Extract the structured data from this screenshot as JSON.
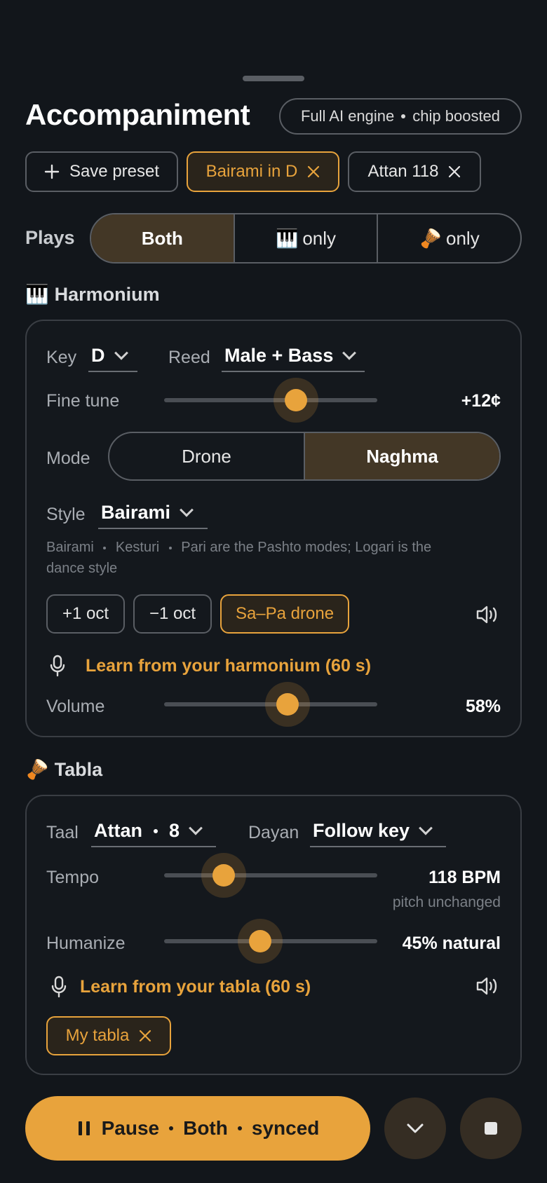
{
  "header": {
    "title": "Accompaniment",
    "engine_left": "Full AI engine",
    "engine_right": "chip boosted"
  },
  "chips": [
    {
      "label": "Save preset",
      "icon": "plus-icon"
    },
    {
      "label": "Bairami in D",
      "active": true
    },
    {
      "label": "Attan 118"
    }
  ],
  "plays": {
    "label": "Plays",
    "options": [
      "Both",
      "only",
      "only"
    ],
    "selected": "Both"
  },
  "harmonium": {
    "heading": "Harmonium",
    "key_label": "Key",
    "key_value": "D",
    "reed_label": "Reed",
    "reed_value": "Male + Bass",
    "fine_tune_label": "Fine tune",
    "fine_tune_value": "+12¢",
    "fine_tune_level": 0.62,
    "mode_label": "Mode",
    "modes": [
      "Drone",
      "Naghma"
    ],
    "mode_selected": "Naghma",
    "style_label": "Style",
    "style_value": "Bairami",
    "hint_a": "Bairami",
    "hint_b": "Kesturi",
    "hint_c": "Pari are the Pashto modes; Logari is the",
    "hint_d": "dance style",
    "buttons": [
      "+1 oct",
      "−1 oct",
      "Sa–Pa drone"
    ],
    "learn": "Learn from your harmonium (60 s)",
    "volume_label": "Volume",
    "volume_value": "58%",
    "volume_level": 0.58
  },
  "tabla": {
    "heading": "Tabla",
    "taal_label": "Taal",
    "taal_name": "Attan",
    "taal_beats": "8",
    "dayan_label": "Dayan",
    "dayan_value": "Follow key",
    "tempo_label": "Tempo",
    "tempo_value": "118 BPM",
    "tempo_note": "pitch unchanged",
    "tempo_level": 0.28,
    "humanize_label": "Humanize",
    "humanize_value": "45% natural",
    "humanize_level": 0.45,
    "learn": "Learn from your tabla (60 s)",
    "chip": "My tabla"
  },
  "footer": {
    "play_a": "Pause",
    "play_b": "Both",
    "play_c": "synced"
  },
  "colors": {
    "accent": "#e8a33c",
    "bg": "#12161b",
    "selected": "#433726"
  }
}
